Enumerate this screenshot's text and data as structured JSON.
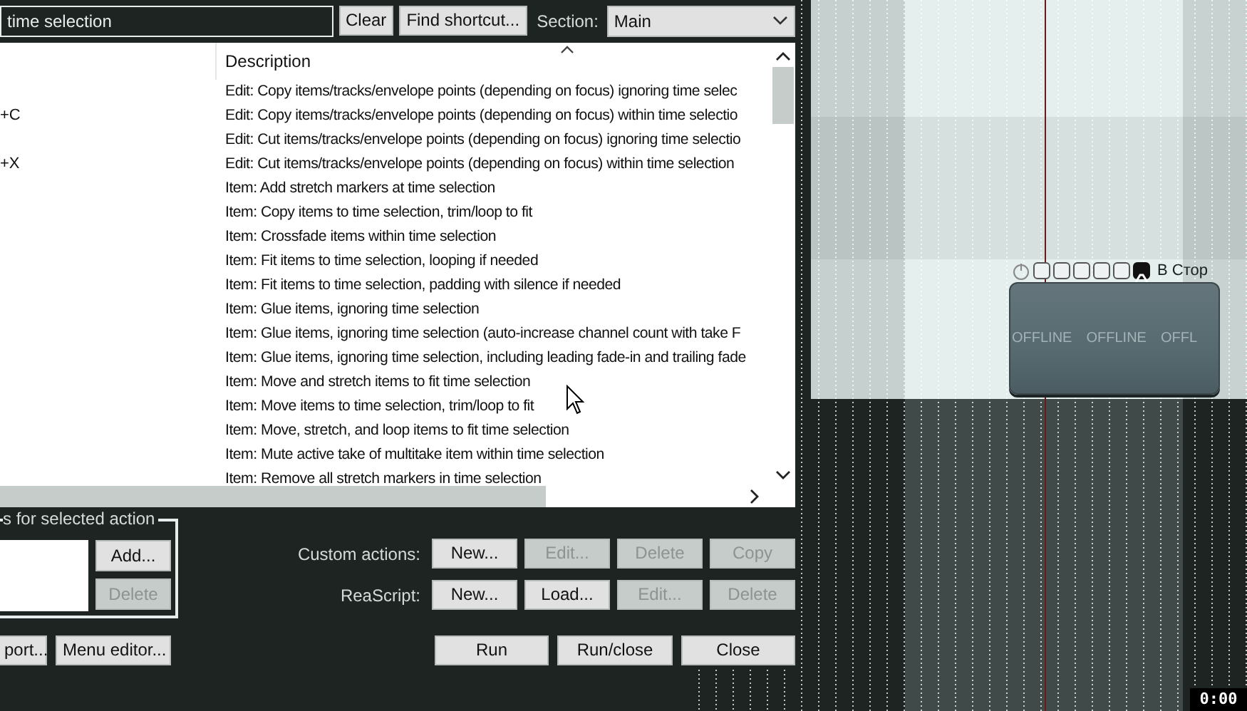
{
  "search": {
    "value": "time selection"
  },
  "top_buttons": [
    "Clear",
    "Find shortcut..."
  ],
  "section": {
    "label": "Section:",
    "value": "Main"
  },
  "list": {
    "columns": [
      "Description"
    ],
    "rows": [
      {
        "shortcut": "",
        "description": "Edit: Copy items/tracks/envelope points (depending on focus) ignoring time selec"
      },
      {
        "shortcut": "+C",
        "description": "Edit: Copy items/tracks/envelope points (depending on focus) within time selectio"
      },
      {
        "shortcut": "",
        "description": "Edit: Cut items/tracks/envelope points (depending on focus) ignoring time selectio"
      },
      {
        "shortcut": "+X",
        "description": "Edit: Cut items/tracks/envelope points (depending on focus) within time selection"
      },
      {
        "shortcut": "",
        "description": "Item: Add stretch markers at time selection"
      },
      {
        "shortcut": "",
        "description": "Item: Copy items to time selection, trim/loop to fit"
      },
      {
        "shortcut": "",
        "description": "Item: Crossfade items within time selection"
      },
      {
        "shortcut": "",
        "description": "Item: Fit items to time selection, looping if needed"
      },
      {
        "shortcut": "",
        "description": "Item: Fit items to time selection, padding with silence if needed"
      },
      {
        "shortcut": "",
        "description": "Item: Glue items, ignoring time selection"
      },
      {
        "shortcut": "",
        "description": "Item: Glue items, ignoring time selection (auto-increase channel count with take F"
      },
      {
        "shortcut": "",
        "description": "Item: Glue items, ignoring time selection, including leading fade-in and trailing fade"
      },
      {
        "shortcut": "",
        "description": "Item: Move and stretch items to fit time selection"
      },
      {
        "shortcut": "",
        "description": "Item: Move items to time selection, trim/loop to fit"
      },
      {
        "shortcut": "",
        "description": "Item: Move, stretch, and loop items to fit time selection"
      },
      {
        "shortcut": "",
        "description": "Item: Mute active take of multitake item within time selection"
      },
      {
        "shortcut": "",
        "description": "Item: Remove all stretch markers in time selection"
      }
    ]
  },
  "shortcuts_group": {
    "title": "s for selected action",
    "buttons": [
      {
        "label": "Add...",
        "disabled": false
      },
      {
        "label": "Delete",
        "disabled": true
      }
    ]
  },
  "custom_actions": {
    "label": "Custom actions:",
    "buttons": [
      {
        "label": "New...",
        "disabled": false
      },
      {
        "label": "Edit...",
        "disabled": true
      },
      {
        "label": "Delete",
        "disabled": true
      },
      {
        "label": "Copy",
        "disabled": true
      }
    ]
  },
  "reascript": {
    "label": "ReaScript:",
    "buttons": [
      {
        "label": "New...",
        "disabled": false
      },
      {
        "label": "Load...",
        "disabled": false
      },
      {
        "label": "Edit...",
        "disabled": true
      },
      {
        "label": "Delete",
        "disabled": true
      }
    ]
  },
  "bottom_left_buttons": [
    "port...",
    "Menu editor..."
  ],
  "bottom_right_buttons": [
    "Run",
    "Run/close",
    "Close"
  ],
  "arrange": {
    "track": {
      "name": "В Стор",
      "envelope_on": true,
      "offline_labels": [
        "OFFLINE",
        "OFFLINE",
        "OFFL"
      ]
    },
    "time": "0:00"
  }
}
